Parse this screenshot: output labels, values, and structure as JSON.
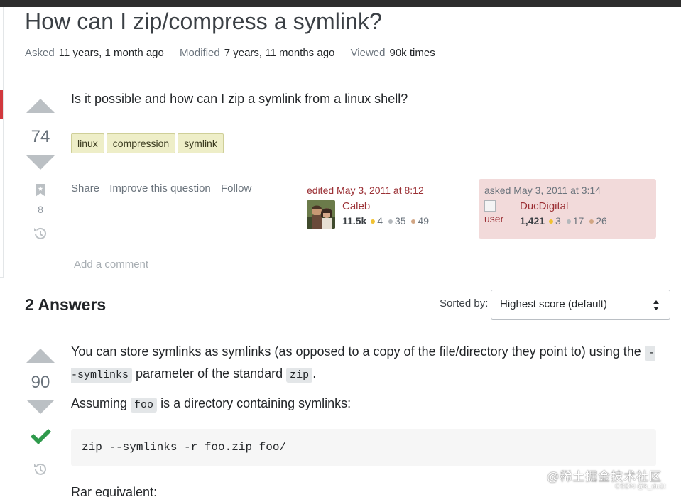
{
  "question": {
    "title": "How can I zip/compress a symlink?",
    "meta": {
      "asked_label": "Asked",
      "asked_value": "11 years, 1 month ago",
      "modified_label": "Modified",
      "modified_value": "7 years, 11 months ago",
      "viewed_label": "Viewed",
      "viewed_value": "90k times"
    },
    "votes": "74",
    "bookmarks": "8",
    "body": "Is it possible and how can I zip a symlink from a linux shell?",
    "tags": [
      "linux",
      "compression",
      "symlink"
    ],
    "menu": {
      "share": "Share",
      "improve": "Improve this question",
      "follow": "Follow"
    },
    "edited": {
      "when": "edited May 3, 2011 at 8:12",
      "user": "Caleb",
      "rep": "11.5k",
      "gold": "4",
      "silver": "35",
      "bronze": "49"
    },
    "asked": {
      "when": "asked May 3, 2011 at 3:14",
      "avatar_alt": "user",
      "user": "DucDigital",
      "rep": "1,421",
      "gold": "3",
      "silver": "17",
      "bronze": "26"
    },
    "add_comment": "Add a comment"
  },
  "answers_header": {
    "title": "2 Answers",
    "sorted_label": "Sorted by:",
    "sort_value": "Highest score (default)"
  },
  "answer": {
    "votes": "90",
    "p1_a": "You can store symlinks as symlinks (as opposed to a copy of the file/directory they point to) using the",
    "p1_code1": "--symlinks",
    "p1_b": "parameter of the standard",
    "p1_code2": "zip",
    "p1_c": ".",
    "p2_a": "Assuming",
    "p2_code": "foo",
    "p2_b": "is a directory containing symlinks:",
    "code_block": "zip --symlinks -r foo.zip foo/",
    "p3": "Rar equivalent:"
  },
  "watermark": {
    "main": "@稀土掘金技术社区",
    "sub": "CSDN @k_du1t"
  },
  "colors": {
    "gold": "#f1c232",
    "silver": "#b4b8bc",
    "bronze": "#d1a684",
    "accent_red": "#d1383d",
    "accepted_green": "#2f9a4c"
  }
}
